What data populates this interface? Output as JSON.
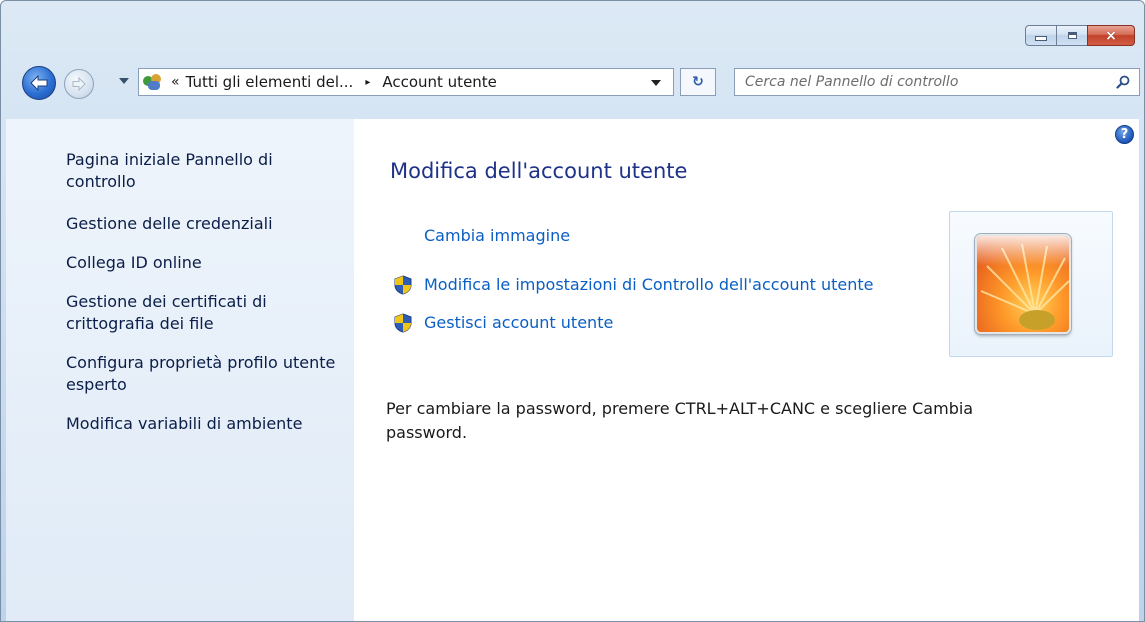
{
  "window": {
    "caption_buttons": {
      "minimize": "minimize",
      "maximize": "maximize",
      "close": "×"
    }
  },
  "navbar": {
    "breadcrumb_overflow": "«",
    "breadcrumb_parent": "Tutti gli elementi del...",
    "breadcrumb_separator": "▸",
    "breadcrumb_current": "Account utente",
    "refresh_glyph": "↻",
    "search_placeholder": "Cerca nel Pannello di controllo"
  },
  "sidebar": {
    "items": [
      {
        "label": "Pagina iniziale Pannello di controllo"
      },
      {
        "label": "Gestione delle credenziali"
      },
      {
        "label": "Collega ID online"
      },
      {
        "label": "Gestione dei certificati di crittografia dei file"
      },
      {
        "label": "Configura proprietà profilo utente esperto"
      },
      {
        "label": "Modifica variabili di ambiente"
      }
    ]
  },
  "main": {
    "title": "Modifica dell'account utente",
    "links": {
      "change_picture": "Cambia immagine",
      "uac_settings": "Modifica le impostazioni di Controllo dell'account utente",
      "manage_accounts": "Gestisci account utente"
    },
    "password_info": "Per cambiare la password, premere CTRL+ALT+CANC e scegliere Cambia password.",
    "help_glyph": "?"
  },
  "colors": {
    "link": "#0a5fc4",
    "title": "#1e3287",
    "sidebar_link": "#0b1e48",
    "close_button": "#c2412a"
  },
  "icons": [
    "arrow-back-icon",
    "arrow-forward-icon",
    "users-icon",
    "refresh-icon",
    "search-icon",
    "uac-shield-icon",
    "help-icon",
    "flower-avatar"
  ]
}
